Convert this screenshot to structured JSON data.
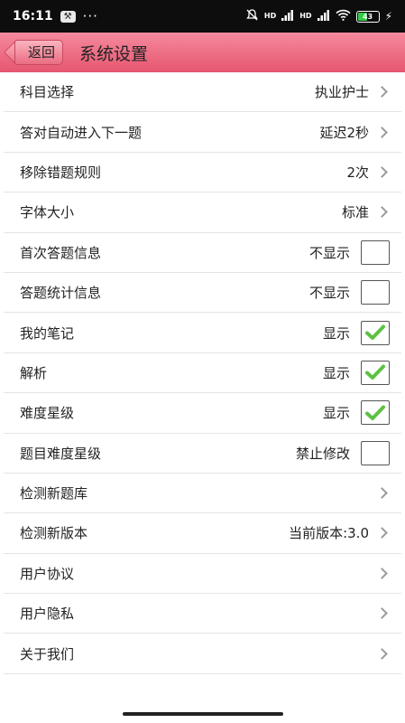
{
  "status_bar": {
    "time": "16:11",
    "dots": "···",
    "hd_label": "HD",
    "battery_level": "43",
    "battery_fraction": 0.43
  },
  "header": {
    "back_label": "返回",
    "title": "系统设置"
  },
  "settings": [
    {
      "label": "科目选择",
      "value": "执业护士",
      "control": "chevron"
    },
    {
      "label": "答对自动进入下一题",
      "value": "延迟2秒",
      "control": "chevron"
    },
    {
      "label": "移除错题规则",
      "value": "2次",
      "control": "chevron"
    },
    {
      "label": "字体大小",
      "value": "标准",
      "control": "chevron"
    },
    {
      "label": "首次答题信息",
      "value": "不显示",
      "control": "checkbox",
      "checked": false
    },
    {
      "label": "答题统计信息",
      "value": "不显示",
      "control": "checkbox",
      "checked": false
    },
    {
      "label": "我的笔记",
      "value": "显示",
      "control": "checkbox",
      "checked": true
    },
    {
      "label": "解析",
      "value": "显示",
      "control": "checkbox",
      "checked": true
    },
    {
      "label": "难度星级",
      "value": "显示",
      "control": "checkbox",
      "checked": true
    },
    {
      "label": "题目难度星级",
      "value": "禁止修改",
      "control": "checkbox",
      "checked": false
    },
    {
      "label": "检测新题库",
      "value": "",
      "control": "chevron"
    },
    {
      "label": "检测新版本",
      "value": "当前版本:3.0",
      "control": "chevron"
    },
    {
      "label": "用户协议",
      "value": "",
      "control": "chevron"
    },
    {
      "label": "用户隐私",
      "value": "",
      "control": "chevron"
    },
    {
      "label": "关于我们",
      "value": "",
      "control": "chevron"
    }
  ],
  "colors": {
    "header_top": "#f58a9e",
    "header_bottom": "#e6566f",
    "check_green": "#5cc242",
    "battery_green": "#38c74a"
  }
}
